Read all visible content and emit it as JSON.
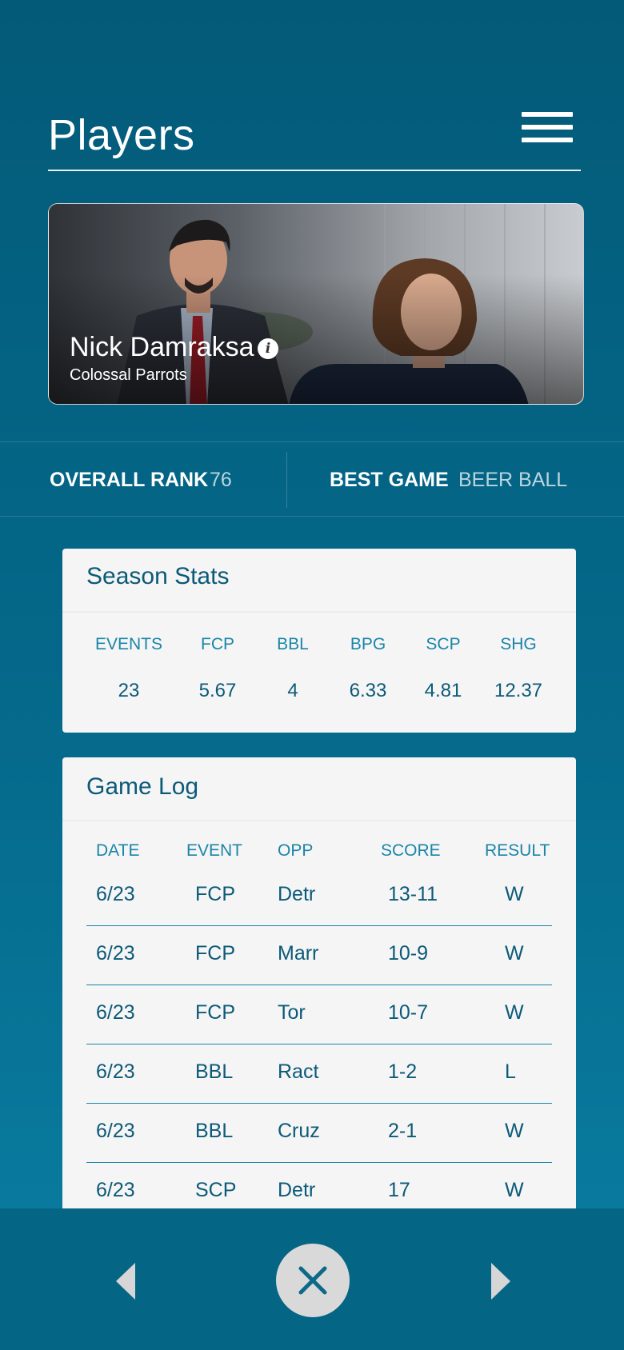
{
  "header": {
    "title": "Players",
    "menu_icon": "hamburger-menu-icon"
  },
  "player": {
    "name": "Nick Damraksa",
    "team": "Colossal Parrots",
    "info_icon": "info-icon"
  },
  "rank": {
    "overall_label": "OVERALL RANK",
    "overall_value": "76",
    "best_label": "BEST GAME",
    "best_value": "BEER BALL"
  },
  "season_stats": {
    "title": "Season Stats",
    "headers": [
      "EVENTS",
      "FCP",
      "BBL",
      "BPG",
      "SCP",
      "SHG"
    ],
    "values": [
      "23",
      "5.67",
      "4",
      "6.33",
      "4.81",
      "12.37"
    ]
  },
  "game_log": {
    "title": "Game Log",
    "headers": [
      "DATE",
      "EVENT",
      "OPP",
      "SCORE",
      "RESULT"
    ],
    "rows": [
      [
        "6/23",
        "FCP",
        "Detr",
        "13-11",
        "W"
      ],
      [
        "6/23",
        "FCP",
        "Marr",
        "10-9",
        "W"
      ],
      [
        "6/23",
        "FCP",
        "Tor",
        "10-7",
        "W"
      ],
      [
        "6/23",
        "BBL",
        "Ract",
        "1-2",
        "L"
      ],
      [
        "6/23",
        "BBL",
        "Cruz",
        "2-1",
        "W"
      ],
      [
        "6/23",
        "SCP",
        "Detr",
        "17",
        "W"
      ]
    ]
  },
  "bottom_nav": {
    "prev_icon": "triangle-left-icon",
    "close_icon": "close-icon",
    "next_icon": "triangle-right-icon"
  }
}
